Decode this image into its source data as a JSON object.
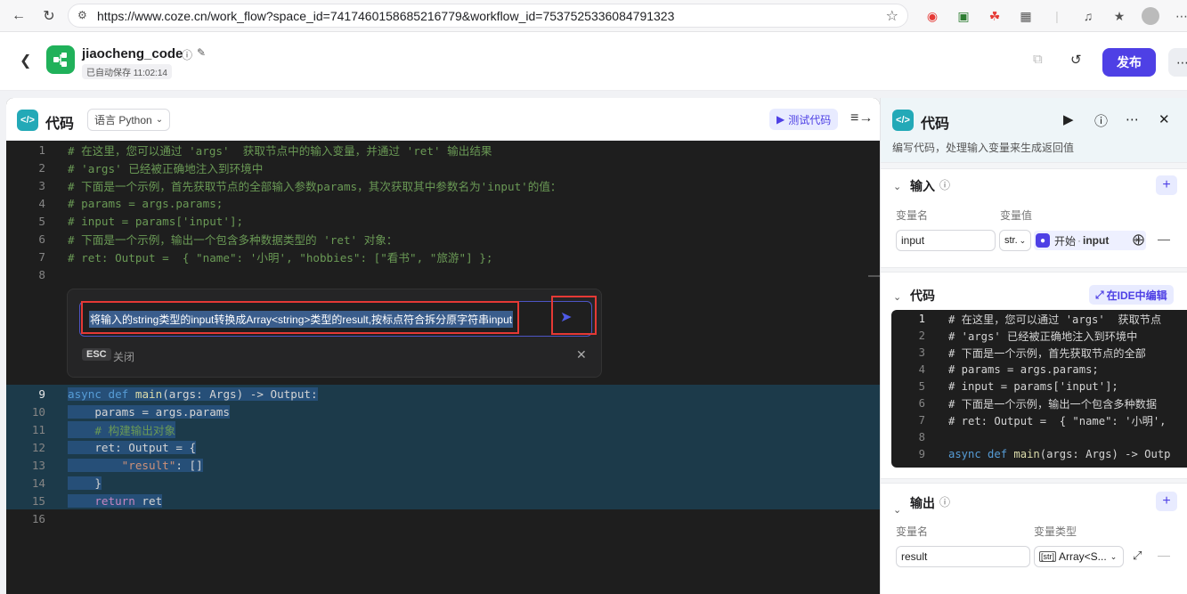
{
  "browser": {
    "url": "https://www.coze.cn/work_flow?space_id=7417460158685216779&workflow_id=7537525336084791323"
  },
  "header": {
    "workflow_name": "jiaocheng_code",
    "autosave": "已自动保存 11:02:14",
    "publish_label": "发布"
  },
  "editor": {
    "title": "代码",
    "language_label": "语言 Python",
    "test_label": "测试代码",
    "lines": [
      {
        "n": "1",
        "text": "# 在这里，您可以通过 'args'  获取节点中的输入变量，并通过 'ret' 输出结果"
      },
      {
        "n": "2",
        "text": "# 'args' 已经被正确地注入到环境中"
      },
      {
        "n": "3",
        "text": "# 下面是一个示例，首先获取节点的全部输入参数params，其次获取其中参数名为'input'的值："
      },
      {
        "n": "4",
        "text": "# params = args.params;"
      },
      {
        "n": "5",
        "text": "# input = params['input'];"
      },
      {
        "n": "6",
        "text": "# 下面是一个示例，输出一个包含多种数据类型的 'ret' 对象："
      },
      {
        "n": "7",
        "text": "# ret: Output =  { \"name\": '小明', \"hobbies\": [\"看书\", \"旅游\"] };"
      },
      {
        "n": "8",
        "text": ""
      }
    ],
    "code_lines": [
      {
        "n": "9",
        "kw1": "async",
        "kw2": "def",
        "fn": "main",
        "rest": "(args: Args) -> Output:"
      },
      {
        "n": "10",
        "text": "    params = args.params"
      },
      {
        "n": "11",
        "text": "    # 构建输出对象"
      },
      {
        "n": "12",
        "text": "    ret: Output = {"
      },
      {
        "n": "13",
        "key": "\"result\"",
        "rest": ": []"
      },
      {
        "n": "14",
        "text": "    }"
      },
      {
        "n": "15",
        "kw": "return",
        "rest": " ret"
      },
      {
        "n": "16",
        "text": ""
      }
    ]
  },
  "ai_prompt": {
    "text": "将输入的string类型的input转换成Array<string>类型的result,按标点符合拆分原字符串input",
    "esc_label": "ESC",
    "close_label": "关闭"
  },
  "right_panel": {
    "title": "代码",
    "description": "编写代码，处理输入变量来生成返回值",
    "input_section": {
      "title": "输入",
      "col_name": "变量名",
      "col_value": "变量值",
      "var_name": "input",
      "var_type": "str.",
      "ref_source": "开始",
      "ref_var": "input"
    },
    "code_section": {
      "title": "代码",
      "ide_label": "在IDE中编辑",
      "lines": [
        {
          "n": "1",
          "text": "# 在这里，您可以通过 'args'  获取节点"
        },
        {
          "n": "2",
          "text": "# 'args' 已经被正确地注入到环境中"
        },
        {
          "n": "3",
          "text": "# 下面是一个示例，首先获取节点的全部"
        },
        {
          "n": "4",
          "text": "# params = args.params;"
        },
        {
          "n": "5",
          "text": "# input = params['input'];"
        },
        {
          "n": "6",
          "text": "# 下面是一个示例，输出一个包含多种数据"
        },
        {
          "n": "7",
          "text": "# ret: Output =  { \"name\": '小明',"
        },
        {
          "n": "8",
          "text": ""
        },
        {
          "n": "9",
          "kw1": "async",
          "kw2": "def",
          "fn": "main",
          "rest": "(args: Args) -> Outp"
        }
      ]
    },
    "output_section": {
      "title": "输出",
      "col_name": "变量名",
      "col_type": "变量类型",
      "var_name": "result",
      "var_type": "Array<S..."
    }
  },
  "colors": {
    "accent": "#4e40e5",
    "brand_green": "#20b15a",
    "code_bg": "#1e1e1e",
    "comment": "#6a9955",
    "keyword": "#569cd6",
    "highlight_box": "#e53935"
  }
}
